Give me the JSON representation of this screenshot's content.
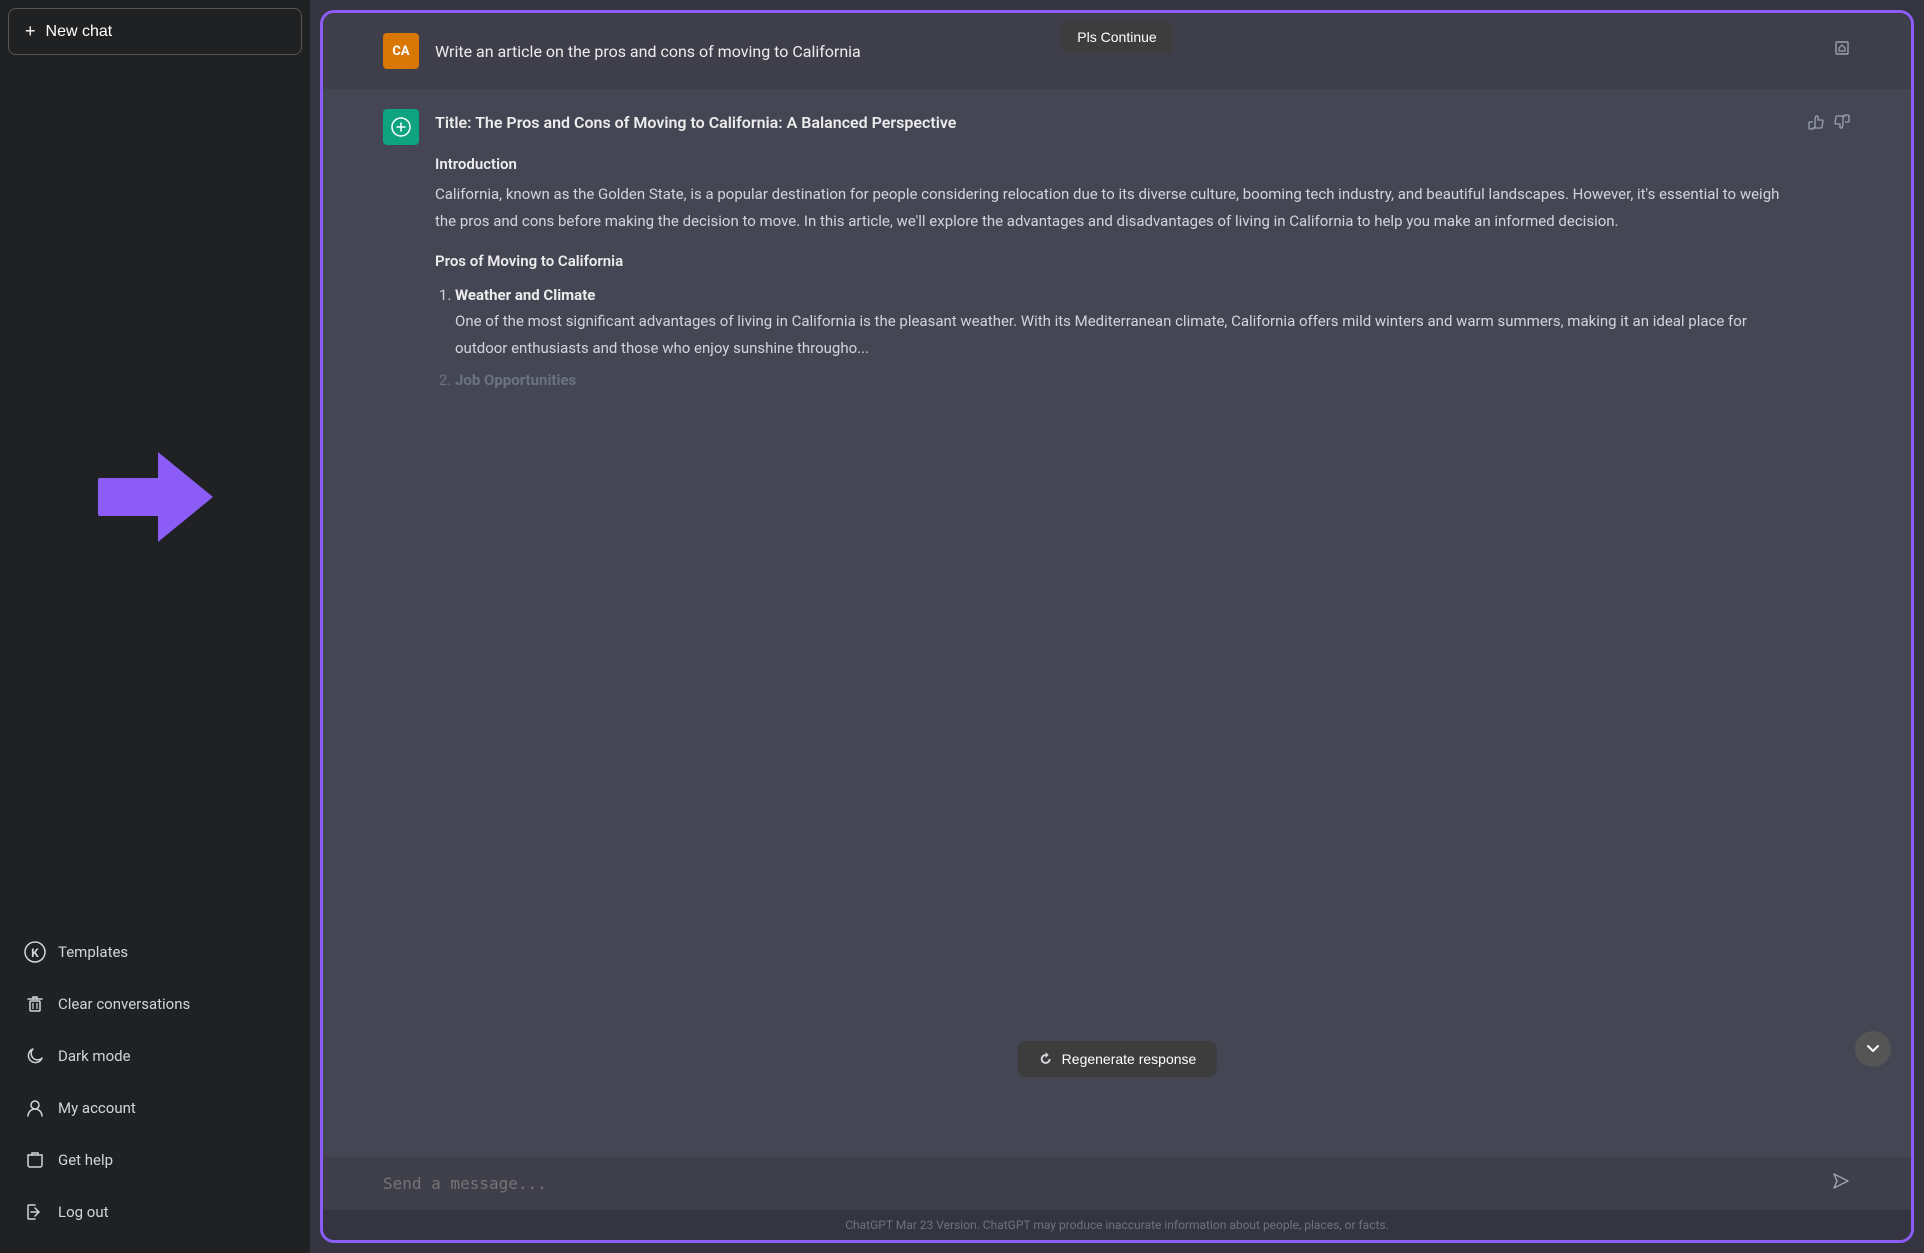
{
  "sidebar": {
    "new_chat_label": "New chat",
    "items": [
      {
        "id": "templates",
        "label": "Templates",
        "icon": "templates-icon"
      },
      {
        "id": "clear-conversations",
        "label": "Clear conversations",
        "icon": "trash-icon"
      },
      {
        "id": "dark-mode",
        "label": "Dark mode",
        "icon": "moon-icon"
      },
      {
        "id": "my-account",
        "label": "My account",
        "icon": "person-icon"
      },
      {
        "id": "get-help",
        "label": "Get help",
        "icon": "help-icon"
      },
      {
        "id": "log-out",
        "label": "Log out",
        "icon": "logout-icon"
      }
    ]
  },
  "chat": {
    "continue_btn_label": "Pls Continue",
    "user_avatar_initials": "CA",
    "user_message": "Write an article on the pros and cons of moving to California",
    "ai_title": "Title: The Pros and Cons of Moving to California: A Balanced Perspective",
    "ai_section_introduction": "Introduction",
    "ai_intro_text": "California, known as the Golden State, is a popular destination for people considering relocation due to its diverse culture, booming tech industry, and beautiful landscapes. However, it's essential to weigh the pros and cons before making the decision to move. In this article, we'll explore the advantages and disadvantages of living in California to help you make an informed decision.",
    "ai_pros_heading": "Pros of Moving to California",
    "ai_pros_items": [
      {
        "number": "1",
        "title": "Weather and Climate",
        "text": "One of the most significant advantages of living in California is the pleasant weather. With its Mediterranean climate, California offers mild winters and warm summers, making it an ideal place for outdoor enthusiasts and those who enjoy sunshine througho..."
      },
      {
        "number": "2",
        "title": "Job Opportunities",
        "text": ""
      }
    ],
    "regenerate_label": "Regenerate response",
    "input_placeholder": "Send a message...",
    "footer_text": "ChatGPT Mar 23 Version. ChatGPT may produce inaccurate information about people, places, or facts."
  }
}
